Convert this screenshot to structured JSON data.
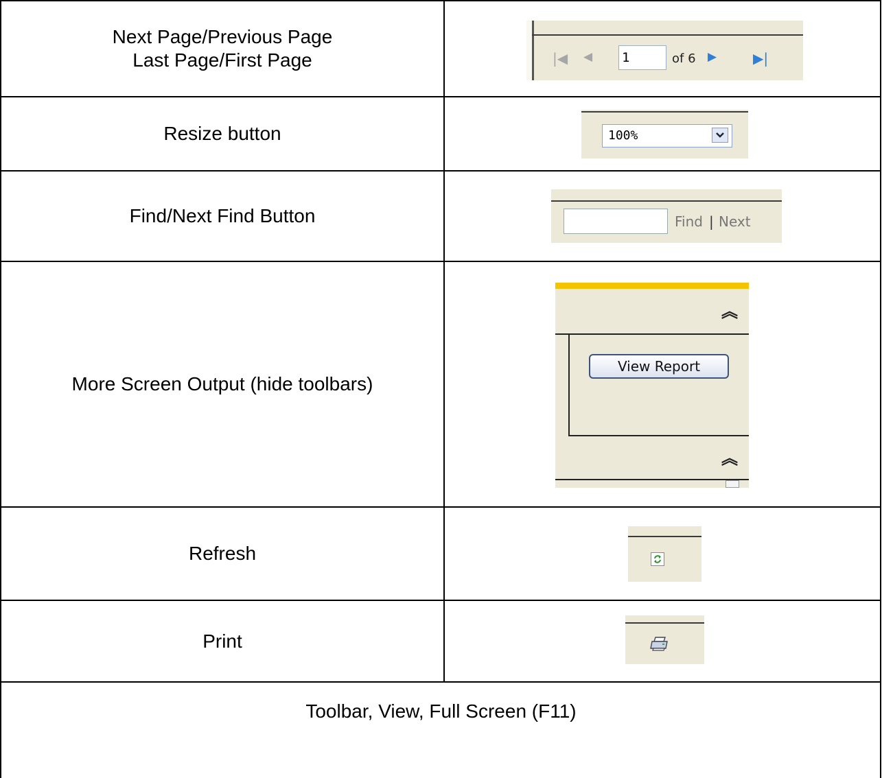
{
  "rows": {
    "paging": {
      "label_line1": "Next Page/Previous Page",
      "label_line2": "Last Page/First Page",
      "current_page": "1",
      "of_text": "of 6",
      "icons": [
        "first-page-icon",
        "previous-page-icon",
        "next-page-icon",
        "last-page-icon"
      ]
    },
    "resize": {
      "label": "Resize button",
      "zoom_value": "100%"
    },
    "find": {
      "label": "Find/Next Find Button",
      "find_link": "Find",
      "separator": "|",
      "next_link": "Next"
    },
    "more": {
      "label": "More Screen Output (hide toolbars)",
      "view_report_button": "View Report"
    },
    "refresh": {
      "label": "Refresh",
      "icon": "refresh-icon"
    },
    "print": {
      "label": "Print",
      "icon": "printer-icon"
    },
    "fullscreen": {
      "label": "Toolbar, View, Full Screen (F11)"
    }
  },
  "colors": {
    "toolbar_bg": "#ece9d8",
    "accent_yellow": "#f5c400",
    "nav_blue": "#2f7fd8"
  }
}
